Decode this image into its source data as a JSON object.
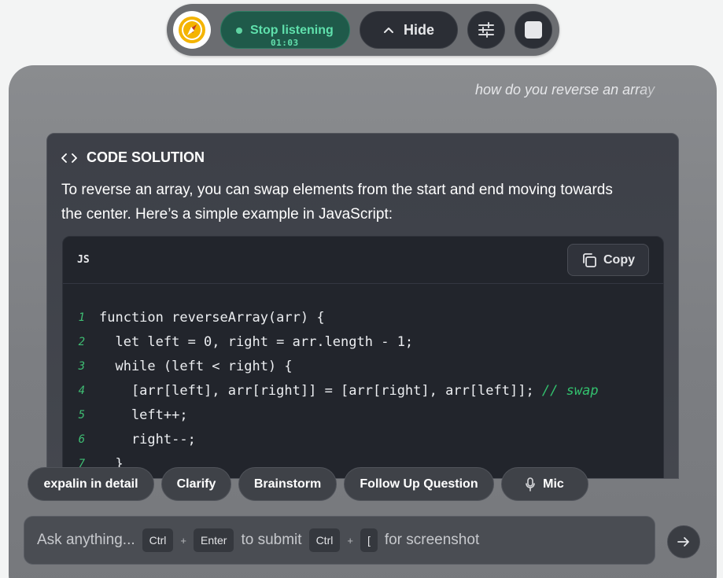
{
  "topbar": {
    "stop_label": "Stop listening",
    "timer": "01:03",
    "hide_label": "Hide",
    "icons": {
      "logo": "compass-logo",
      "hide": "chevron-up-icon",
      "settings": "sliders-icon",
      "stop": "square-stop-icon"
    }
  },
  "query": "how do you reverse an array",
  "card": {
    "title": "CODE SOLUTION",
    "description": "To reverse an array, you can swap elements from the start and end moving towards the center. Here’s a simple example in JavaScript:",
    "code": {
      "language": "JS",
      "copy_label": "Copy",
      "lines": [
        {
          "n": "1",
          "text": "function reverseArray(arr) {",
          "comment": ""
        },
        {
          "n": "2",
          "text": "  let left = 0, right = arr.length - 1;",
          "comment": ""
        },
        {
          "n": "3",
          "text": "  while (left < right) {",
          "comment": ""
        },
        {
          "n": "4",
          "text": "    [arr[left], arr[right]] = [arr[right], arr[left]]; ",
          "comment": "// swap"
        },
        {
          "n": "5",
          "text": "    left++;",
          "comment": ""
        },
        {
          "n": "6",
          "text": "    right--;",
          "comment": ""
        },
        {
          "n": "7",
          "text": "  }",
          "comment": ""
        }
      ]
    }
  },
  "chips": {
    "explain": "expalin in detail",
    "clarify": "Clarify",
    "brainstorm": "Brainstorm",
    "follow_up": "Follow Up Question",
    "mic": "Mic"
  },
  "input": {
    "placeholder": "Ask anything...",
    "submit_key_1": "Ctrl",
    "submit_key_2": "Enter",
    "submit_text": "to submit",
    "shot_key_1": "Ctrl",
    "shot_key_2": "[",
    "shot_text": "for screenshot",
    "plus": "+"
  },
  "colors": {
    "accent_green": "#5fe0ac",
    "code_bg": "#22252c",
    "comment_green": "#33c16e"
  }
}
